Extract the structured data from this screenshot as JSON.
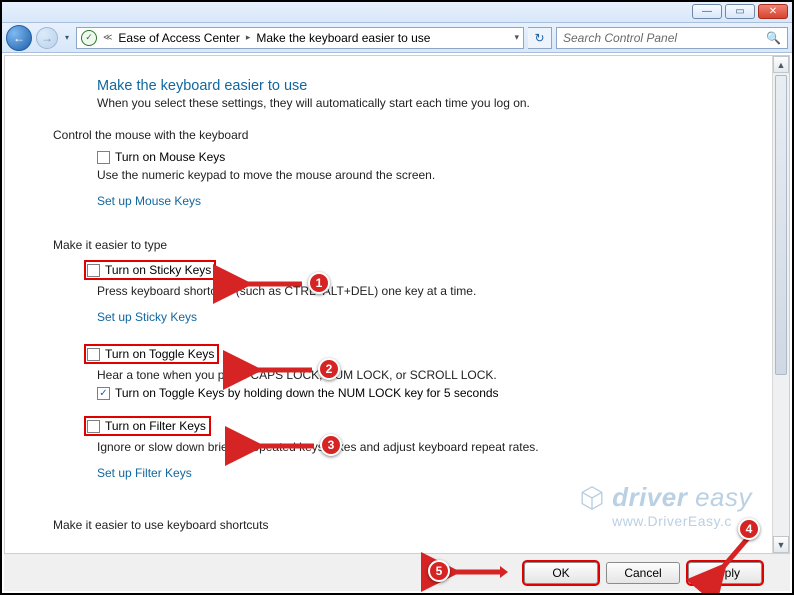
{
  "window": {
    "minimize": "—",
    "maximize": "▭",
    "close": "✕"
  },
  "nav": {
    "back": "←",
    "fwd": "→",
    "split": "▾",
    "crumb1": "Ease of Access Center",
    "crumb2": "Make the keyboard easier to use",
    "refresh": "↻",
    "search_placeholder": "Search Control Panel"
  },
  "page": {
    "title": "Make the keyboard easier to use",
    "subtitle": "When you select these settings, they will automatically start each time you log on."
  },
  "mouse": {
    "header": "Control the mouse with the keyboard",
    "cb_label": "Turn on Mouse Keys",
    "desc": "Use the numeric keypad to move the mouse around the screen.",
    "link": "Set up Mouse Keys"
  },
  "type": {
    "header": "Make it easier to type",
    "sticky_label": "Turn on Sticky Keys",
    "sticky_desc": "Press keyboard shortcuts (such as CTRL+ALT+DEL) one key at a time.",
    "sticky_link": "Set up Sticky Keys",
    "toggle_label": "Turn on Toggle Keys",
    "toggle_desc": "Hear a tone when you press CAPS LOCK, NUM LOCK, or SCROLL LOCK.",
    "toggle_sub_label": "Turn on Toggle Keys by holding down the NUM LOCK key for 5 seconds",
    "filter_label": "Turn on Filter Keys",
    "filter_desc": "Ignore or slow down brief or repeated keystrokes and adjust keyboard repeat rates.",
    "filter_link": "Set up Filter Keys"
  },
  "shortcuts": {
    "header": "Make it easier to use keyboard shortcuts"
  },
  "buttons": {
    "ok": "OK",
    "cancel": "Cancel",
    "apply": "Apply"
  },
  "annotations": {
    "n1": "1",
    "n2": "2",
    "n3": "3",
    "n4": "4",
    "n5": "5"
  },
  "watermark": {
    "brand1": "driver",
    "brand2": "easy",
    "url": "www.DriverEasy.c"
  }
}
